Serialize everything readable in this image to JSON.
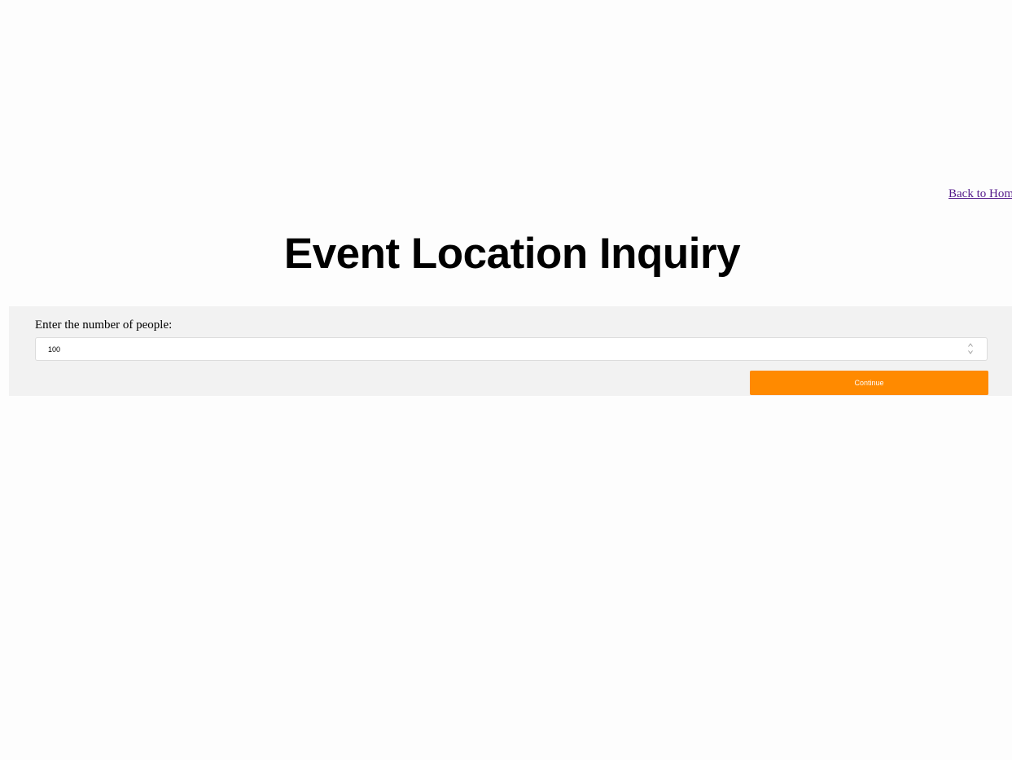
{
  "nav": {
    "back_link": "Back to Hom"
  },
  "page": {
    "title": "Event Location Inquiry"
  },
  "form": {
    "people_label": "Enter the number of people:",
    "people_value": "100",
    "continue_label": "Continue"
  },
  "icons": {
    "stepper": "stepper-updown-icon"
  },
  "colors": {
    "accent": "#ff8a00",
    "link": "#551a8b",
    "panel": "#f2f2f2"
  }
}
